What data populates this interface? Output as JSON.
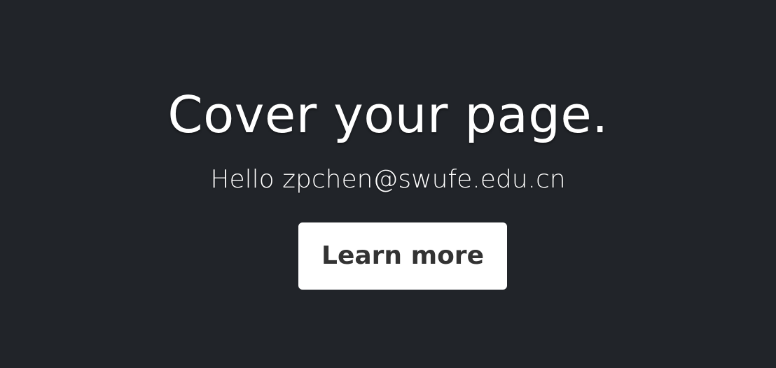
{
  "cover": {
    "heading": "Cover your page.",
    "lead": "Hello zpchen@swufe.edu.cn",
    "button_label": "Learn more"
  },
  "colors": {
    "background": "#212429",
    "text": "#ffffff",
    "button_background": "#ffffff",
    "button_text": "#333333"
  }
}
